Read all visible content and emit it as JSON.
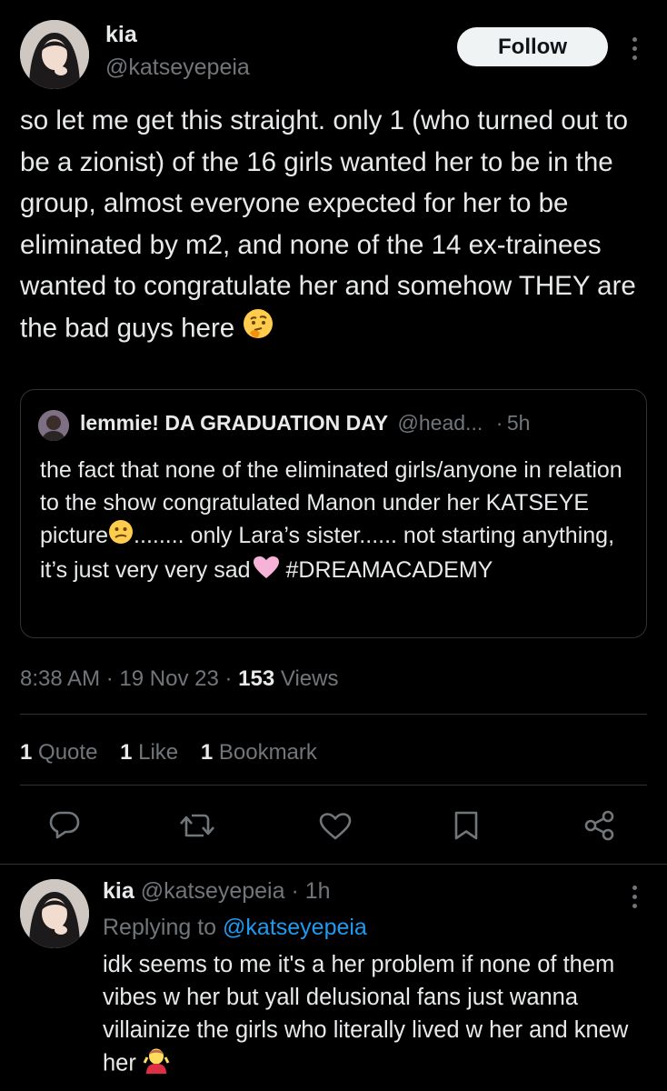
{
  "tweet": {
    "author_name": "kia",
    "author_handle": "@katseyepeia",
    "follow_label": "Follow",
    "text": "so let me get this straight. only 1 (who turned out to be a zionist) of the 16 girls wanted her to be in the group, almost everyone expected for her to be eliminated by m2, and none of the 14 ex-trainees wanted to congratulate her and somehow THEY are the bad guys here",
    "text_emoji_icon": "thinking-face-icon",
    "time": "8:38 AM",
    "date": "19 Nov 23",
    "views_count": "153",
    "views_label": "Views",
    "stats": {
      "quotes_count": "1",
      "quotes_label": "Quote",
      "likes_count": "1",
      "likes_label": "Like",
      "bookmarks_count": "1",
      "bookmarks_label": "Bookmark"
    }
  },
  "quote": {
    "author_name": "lemmie! DA GRADUATION DAY",
    "author_handle": "@head...",
    "time": "5h",
    "text_part1": "the fact that none of the eliminated girls/anyone in relation to the show congratulated Manon under her KATSEYE picture",
    "text_part2": "........ only Lara’s sister...... not starting anything, it’s just very very sad",
    "text_part3": " #DREAMACADEMY",
    "emoji1": "confused-face-icon",
    "emoji2": "pink-heart-icon"
  },
  "actions": [
    "reply-icon",
    "retweet-icon",
    "like-icon",
    "bookmark-icon",
    "share-icon"
  ],
  "reply": {
    "author_name": "kia",
    "author_handle": "@katseyepeia",
    "time": "1h",
    "replying_to_label": "Replying to",
    "replying_to_handle": "@katseyepeia",
    "text": "idk seems to me it's a her problem if none of them vibes w her but yall delusional fans just wanna villainize the girls who literally lived w her and knew her",
    "text_emoji_icon": "person-shrugging-icon"
  },
  "colors": {
    "background": "#000000",
    "text": "#e7e9ea",
    "secondary": "#71767b",
    "link": "#1d9bf0",
    "border": "#2f3336",
    "follow_bg": "#eff3f4"
  }
}
